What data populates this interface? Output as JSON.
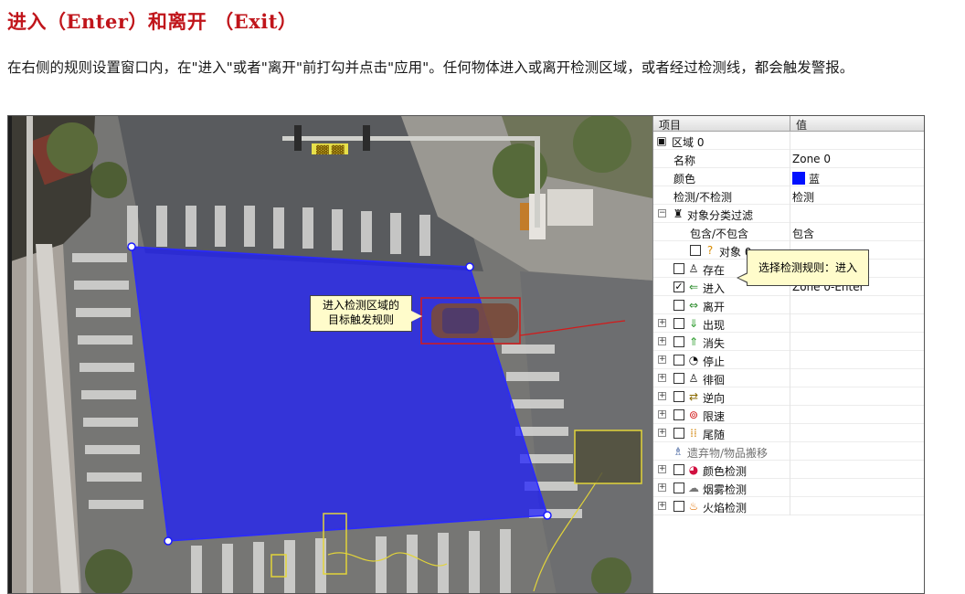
{
  "heading": "进入（Enter）和离开 （Exit）",
  "description": "在右侧的规则设置窗口内，在\"进入\"或者\"离开\"前打勾并点击\"应用\"。任何物体进入或离开检测区域，或者经过检测线，都会触发警报。",
  "video": {
    "callout": [
      "进入检测区域的",
      "目标触发规则"
    ],
    "sign_text": "▓▓ ▓▓",
    "zone_color": "#1a1aff"
  },
  "panel": {
    "col_item": "项目",
    "col_value": "值",
    "tooltip": "选择检测规则：进入",
    "rows": [
      {
        "label": "区域 0",
        "value": "",
        "icon": "zone-icon"
      },
      {
        "label": "名称",
        "value": "Zone 0"
      },
      {
        "label": "颜色",
        "value": "蓝",
        "swatch": "#0010ff"
      },
      {
        "label": "检测/不检测",
        "value": "检测"
      },
      {
        "label": "对象分类过滤",
        "value": "",
        "icon": "filter-icon"
      },
      {
        "label": "包含/不包含",
        "value": "包含"
      },
      {
        "label": "对象 0",
        "value": "",
        "icon": "question-icon"
      },
      {
        "label": "存在",
        "value": "",
        "icon": "person-icon"
      },
      {
        "label": "进入",
        "value": "Zone 0-Enter",
        "icon": "enter-icon",
        "checked": true
      },
      {
        "label": "离开",
        "value": "",
        "icon": "exit-icon"
      },
      {
        "label": "出现",
        "value": "",
        "icon": "appear-icon"
      },
      {
        "label": "消失",
        "value": "",
        "icon": "disappear-icon"
      },
      {
        "label": "停止",
        "value": "",
        "icon": "stop-icon"
      },
      {
        "label": "徘徊",
        "value": "",
        "icon": "loiter-icon"
      },
      {
        "label": "逆向",
        "value": "",
        "icon": "reverse-icon"
      },
      {
        "label": "限速",
        "value": "",
        "icon": "speed-limit-icon"
      },
      {
        "label": "尾随",
        "value": "",
        "icon": "tailgate-icon"
      },
      {
        "label": "遗弃物/物品搬移",
        "value": "",
        "icon": "abandoned-icon"
      },
      {
        "label": "颜色检测",
        "value": "",
        "icon": "color-detect-icon"
      },
      {
        "label": "烟雾检测",
        "value": "",
        "icon": "smoke-icon"
      },
      {
        "label": "火焰检测",
        "value": "",
        "icon": "fire-icon"
      }
    ]
  }
}
